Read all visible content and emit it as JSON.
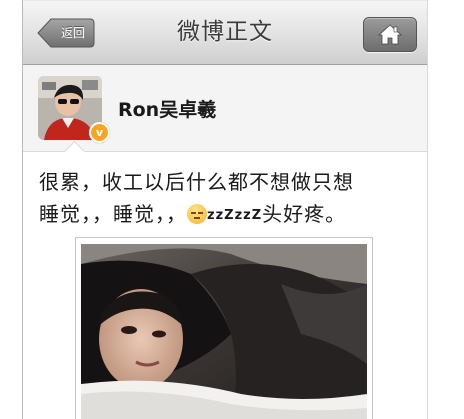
{
  "navbar": {
    "back_label": "返回",
    "title": "微博正文"
  },
  "user": {
    "name": "Ron吴卓羲",
    "verified_badge": "v"
  },
  "post": {
    "line1": "很累，收工以后什么都不想做只想",
    "line2_before_emoji": "睡觉，，睡觉，，",
    "zzz": "zzZ",
    "line2_after": "头好疼。"
  },
  "colors": {
    "navbar_bg": "#e2e2e2",
    "back_button": "#8e8e8e",
    "home_button": "#7a7a7a",
    "verified_badge": "#f5a623",
    "text": "#1a1a1a"
  },
  "icons": {
    "home": "home-icon",
    "sleepy_emoji": "sleepy-face-icon"
  }
}
